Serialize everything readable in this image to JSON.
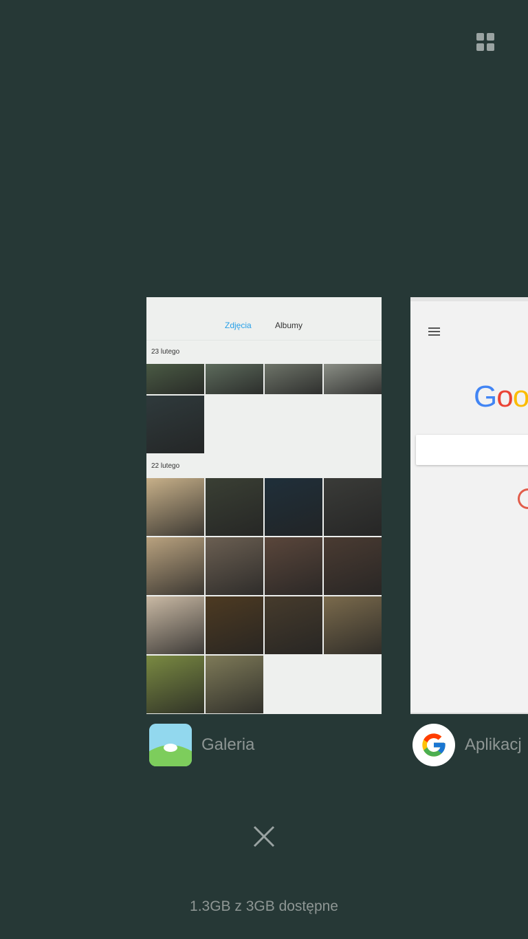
{
  "gallery_card": {
    "tabs": [
      {
        "label": "Zdjęcia",
        "active": true
      },
      {
        "label": "Albumy",
        "active": false
      }
    ],
    "sections": [
      {
        "date": "23 lutego",
        "rows": [
          [
            "#4a5a44",
            "#5d6b5c",
            "#6e7469",
            "#8a8e85"
          ],
          [
            "#2f3a3c"
          ]
        ]
      },
      {
        "date": "22 lutego",
        "rows": [
          [
            "#c7b089",
            "#3a3f34",
            "#1f2f3a",
            "#3a3b38"
          ],
          [
            "#b9a27f",
            "#6b5f52",
            "#5a463b",
            "#4a3b32"
          ],
          [
            "#c9b9a4",
            "#4d3a22",
            "#463b2c",
            "#7a6a4c"
          ],
          [
            "#7a8a42",
            "#7e7a58"
          ]
        ]
      }
    ]
  },
  "google_card": {
    "logo_text": "Goo",
    "logo_colors": [
      "#4285f4",
      "#ea4335",
      "#fbbc05"
    ]
  },
  "apps": [
    {
      "name": "Galeria",
      "icon": "gallery-icon"
    },
    {
      "name": "Aplikacj",
      "icon": "google-g-icon"
    }
  ],
  "memory_status": "1.3GB z 3GB dostępne",
  "colors": {
    "background": "#263836",
    "accent_tab": "#27a0e8",
    "label_text": "#8e9694"
  }
}
